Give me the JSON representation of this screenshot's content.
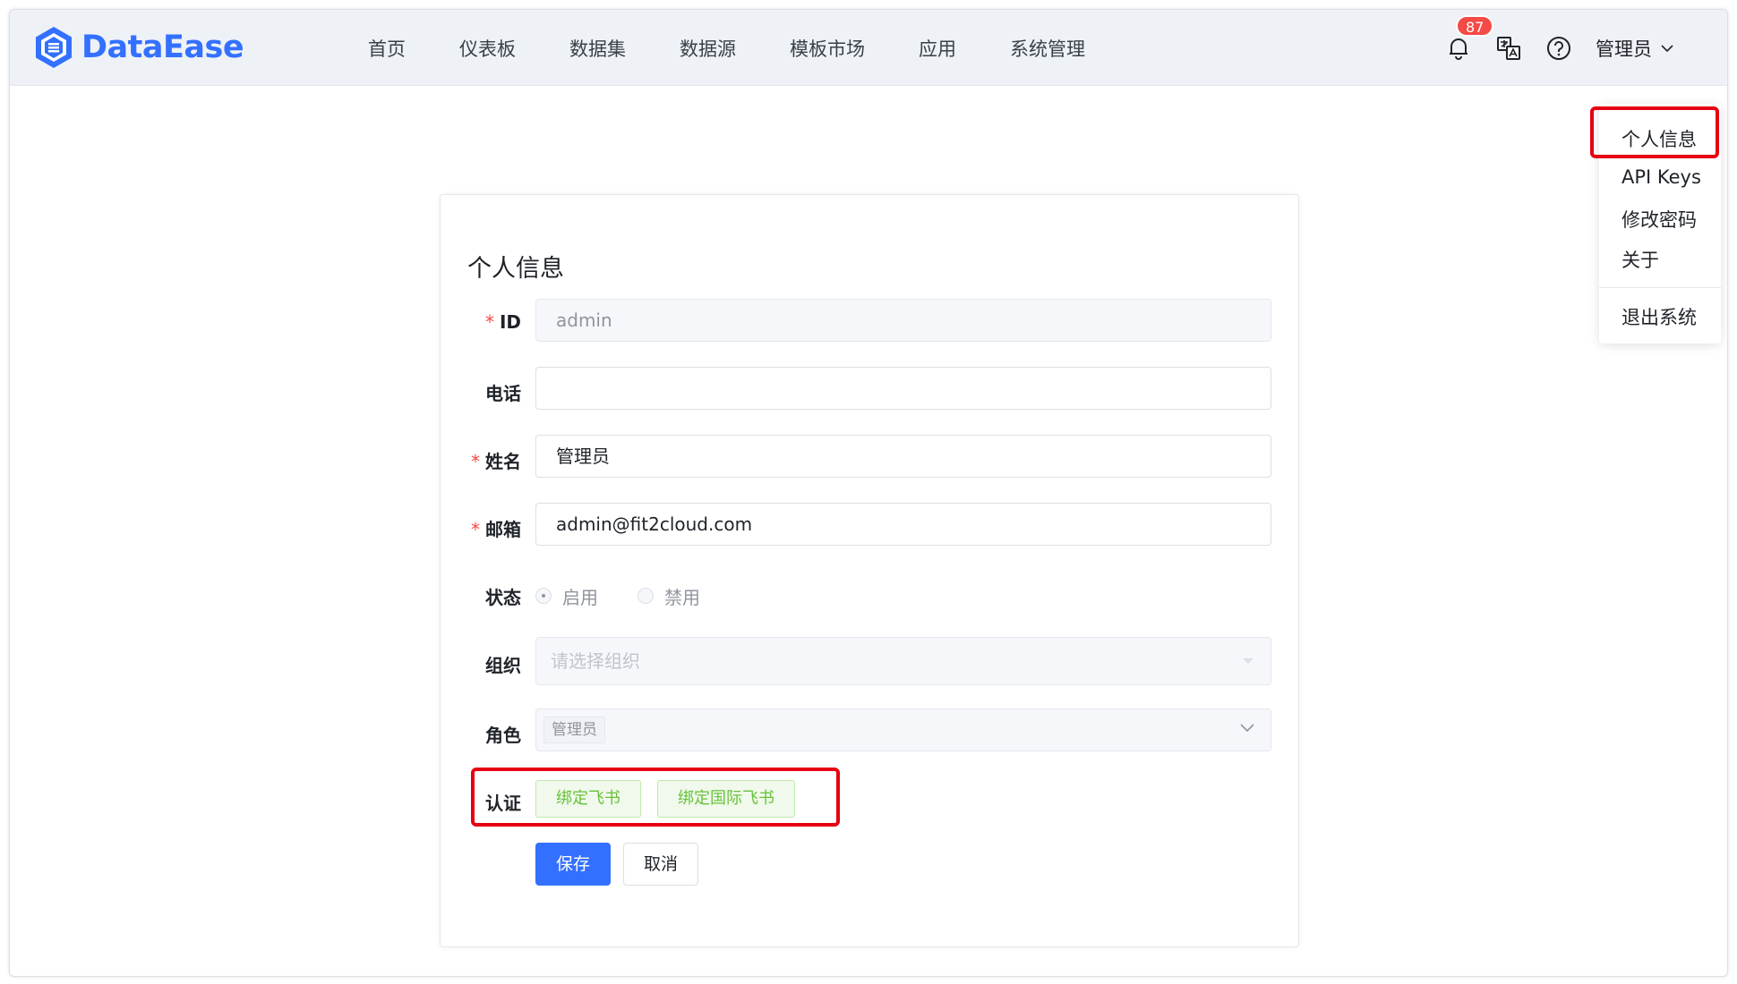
{
  "app": {
    "logo_text": "DataEase"
  },
  "nav": {
    "items": [
      {
        "label": "首页"
      },
      {
        "label": "仪表板"
      },
      {
        "label": "数据集"
      },
      {
        "label": "数据源"
      },
      {
        "label": "模板市场"
      },
      {
        "label": "应用"
      },
      {
        "label": "系统管理"
      }
    ]
  },
  "toolbar": {
    "notification_count": "87",
    "user_name": "管理员"
  },
  "user_menu": {
    "items": [
      {
        "label": "个人信息"
      },
      {
        "label": "API Keys"
      },
      {
        "label": "修改密码"
      },
      {
        "label": "关于"
      },
      {
        "label": "退出系统"
      }
    ]
  },
  "form": {
    "title": "个人信息",
    "id": {
      "label": "ID",
      "value": "admin"
    },
    "phone": {
      "label": "电话",
      "value": ""
    },
    "name": {
      "label": "姓名",
      "value": "管理员"
    },
    "email": {
      "label": "邮箱",
      "value": "admin@fit2cloud.com"
    },
    "status": {
      "label": "状态",
      "options": [
        "启用",
        "禁用"
      ],
      "selected": "启用"
    },
    "org": {
      "label": "组织",
      "placeholder": "请选择组织"
    },
    "role": {
      "label": "角色",
      "tag": "管理员"
    },
    "auth": {
      "label": "认证",
      "bind_feishu": "绑定飞书",
      "bind_lark": "绑定国际飞书"
    },
    "save_label": "保存",
    "cancel_label": "取消"
  },
  "colors": {
    "brand": "#3370ff",
    "required": "#f54a45",
    "highlight": "#e60012",
    "success": "#67c23a"
  }
}
